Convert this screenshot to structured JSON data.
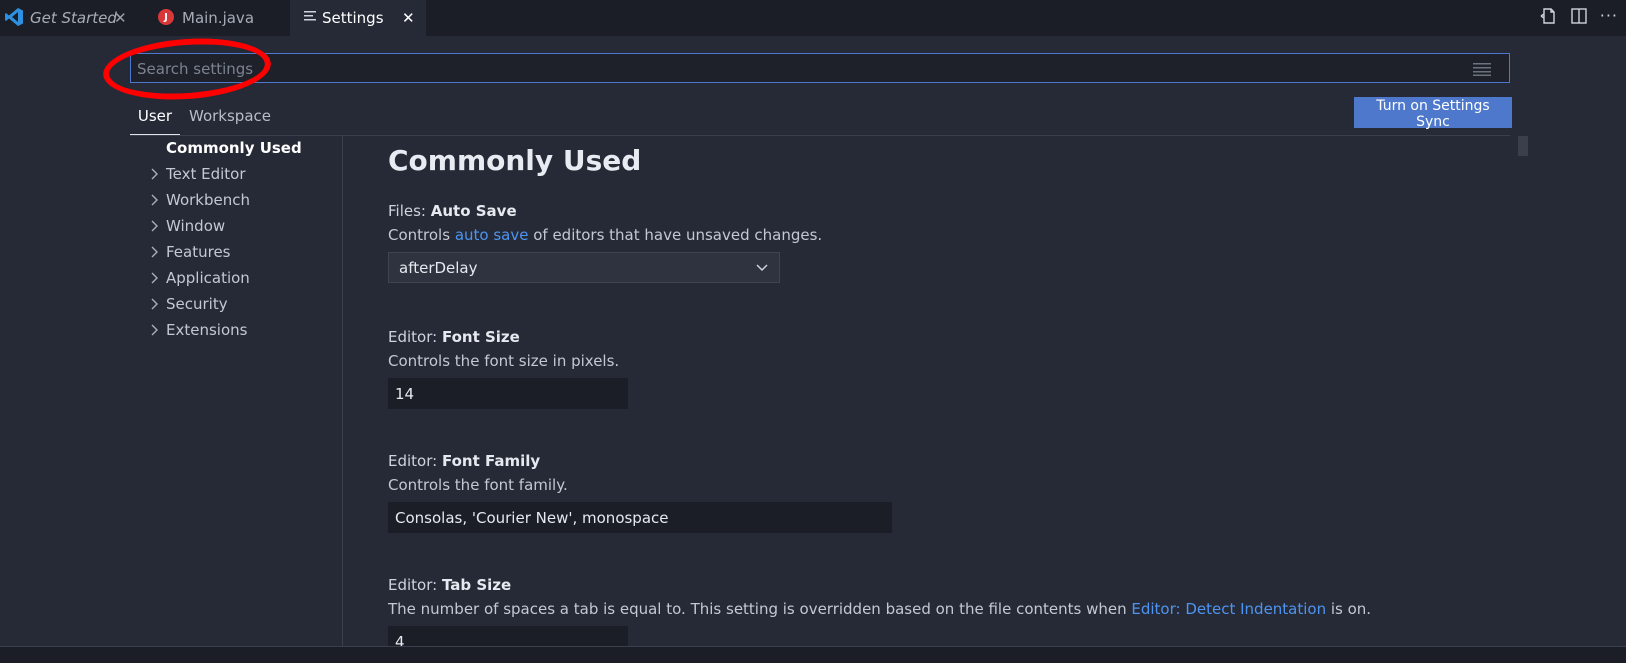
{
  "tabs": [
    {
      "label": "Get Started",
      "icon": "vscode-logo-icon"
    },
    {
      "label": "Main.java",
      "icon": "java-file-icon",
      "badge": "J"
    },
    {
      "label": "Settings",
      "icon": "settings-file-icon"
    }
  ],
  "colors": {
    "accent": "#4d78cc",
    "link": "#4e94f0",
    "annotation": "#ff0000",
    "background": "#252a36",
    "tabbar": "#1b1e26"
  },
  "search": {
    "placeholder": "Search settings",
    "value": ""
  },
  "scopes": {
    "user": "User",
    "workspace": "Workspace"
  },
  "sync_button": "Turn on Settings Sync",
  "toc": [
    {
      "label": "Commonly Used",
      "active": true
    },
    {
      "label": "Text Editor"
    },
    {
      "label": "Workbench"
    },
    {
      "label": "Window"
    },
    {
      "label": "Features"
    },
    {
      "label": "Application"
    },
    {
      "label": "Security"
    },
    {
      "label": "Extensions"
    }
  ],
  "section_title": "Commonly Used",
  "settings": {
    "auto_save": {
      "category": "Files: ",
      "name": "Auto Save",
      "desc_before": "Controls ",
      "desc_link": "auto save",
      "desc_after": " of editors that have unsaved changes.",
      "value": "afterDelay"
    },
    "font_size": {
      "category": "Editor: ",
      "name": "Font Size",
      "desc": "Controls the font size in pixels.",
      "value": "14"
    },
    "font_family": {
      "category": "Editor: ",
      "name": "Font Family",
      "desc": "Controls the font family.",
      "value": "Consolas, 'Courier New', monospace"
    },
    "tab_size": {
      "category": "Editor: ",
      "name": "Tab Size",
      "desc_before": "The number of spaces a tab is equal to. This setting is overridden based on the file contents when ",
      "desc_link": "Editor: Detect Indentation",
      "desc_after": " is on.",
      "value": "4"
    }
  }
}
